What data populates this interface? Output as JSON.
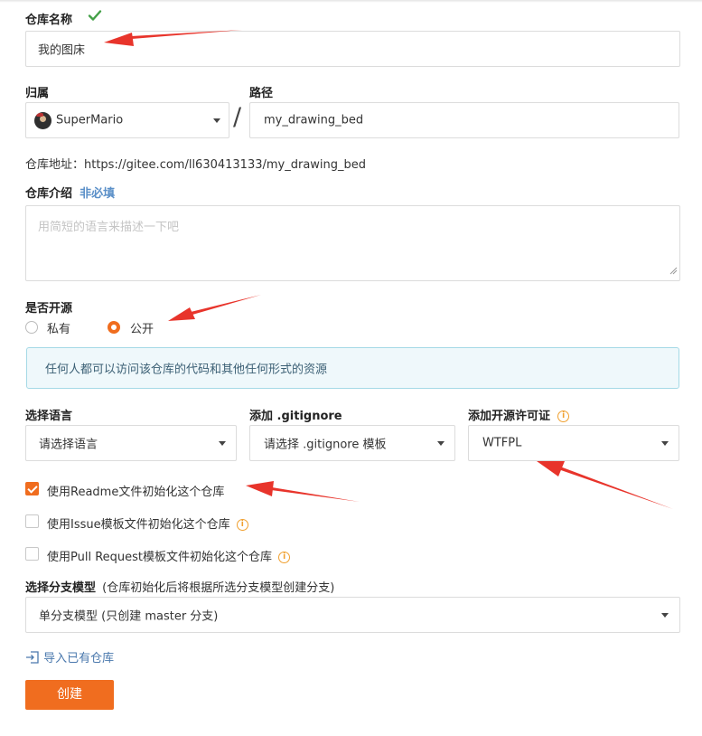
{
  "repo_name": {
    "label": "仓库名称",
    "value": "我的图床"
  },
  "owner": {
    "label": "归属",
    "value": "SuperMario"
  },
  "path": {
    "label": "路径",
    "value": "my_drawing_bed",
    "separator": "/"
  },
  "repo_url": {
    "text": "仓库地址：https://gitee.com/ll630413133/my_drawing_bed"
  },
  "description": {
    "label": "仓库介绍",
    "optional": "非必填",
    "placeholder": "用简短的语言来描述一下吧"
  },
  "visibility": {
    "label": "是否开源",
    "private_label": "私有",
    "public_label": "公开",
    "selected": "public",
    "notice": "任何人都可以访问该仓库的代码和其他任何形式的资源"
  },
  "language": {
    "label": "选择语言",
    "value": "请选择语言"
  },
  "gitignore": {
    "label": "添加 .gitignore",
    "value": "请选择 .gitignore 模板"
  },
  "license": {
    "label": "添加开源许可证",
    "value": "WTFPL"
  },
  "init": {
    "readme": {
      "label": "使用Readme文件初始化这个仓库",
      "checked": true
    },
    "issue": {
      "label": "使用Issue模板文件初始化这个仓库",
      "checked": false
    },
    "pr": {
      "label": "使用Pull Request模板文件初始化这个仓库",
      "checked": false
    }
  },
  "branch_model": {
    "label": "选择分支模型",
    "hint": "(仓库初始化后将根据所选分支模型创建分支)",
    "value": "单分支模型 (只创建 master 分支)"
  },
  "import_link": "导入已有仓库",
  "create_button": "创建",
  "colors": {
    "accent": "#f06d1f",
    "check": "#43a047",
    "arrow": "#e8342b",
    "notice_bg": "#eff8fb",
    "notice_border": "#a5d9e6"
  }
}
